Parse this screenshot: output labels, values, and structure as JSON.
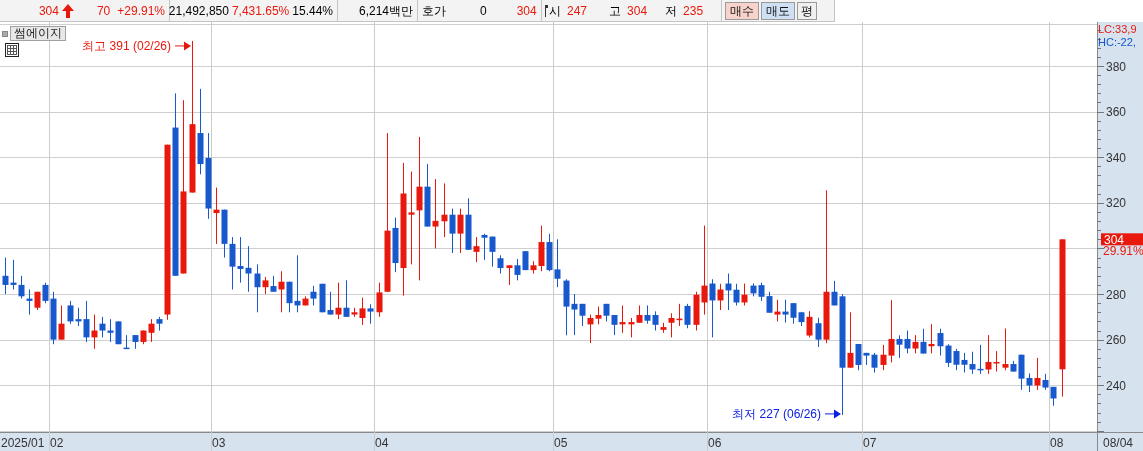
{
  "quote_bar": {
    "price": "304",
    "change": "70",
    "change_rate": "+29.91%",
    "volume": "21,492,850",
    "volume_rate": "7,431.65%",
    "turnover_rate": "15.44%",
    "amount": "6,214백만",
    "bid_ask_label": "호가",
    "bid_ask_qty": "0",
    "bid_ask_price": "304",
    "open_label": "시",
    "open": "247",
    "high_label": "고",
    "high": "304",
    "low_label": "저",
    "low": "235"
  },
  "buttons": [
    {
      "label": "매수",
      "kind": "buy"
    },
    {
      "label": "매도",
      "kind": "sell"
    },
    {
      "label": "평",
      "kind": "plain"
    }
  ],
  "chart": {
    "stock_button": "썸에이지",
    "lc_label": "LC:33,9",
    "hc_label": "HC:-22,",
    "last_price_tag": "304",
    "last_change_tag": "29.91%",
    "x_axis_start_label": "2025/01",
    "x_axis_end_label": "08/04",
    "chart_data": {
      "type": "candlestick",
      "grid": true,
      "ylim": [
        219.5,
        399.3
      ],
      "yticks": [
        240,
        260,
        280,
        320,
        340,
        360,
        380
      ],
      "categories": [
        null,
        null,
        null,
        null,
        null,
        null,
        "02",
        null,
        null,
        null,
        null,
        null,
        null,
        null,
        null,
        null,
        null,
        null,
        null,
        null,
        null,
        null,
        null,
        null,
        null,
        null,
        "03",
        null,
        null,
        null,
        null,
        null,
        null,
        null,
        null,
        null,
        null,
        null,
        null,
        null,
        null,
        null,
        null,
        null,
        null,
        null,
        "04",
        null,
        null,
        null,
        null,
        null,
        null,
        null,
        null,
        null,
        null,
        null,
        null,
        null,
        null,
        null,
        null,
        null,
        null,
        null,
        null,
        null,
        "05",
        null,
        null,
        null,
        null,
        null,
        null,
        null,
        null,
        null,
        null,
        null,
        null,
        null,
        null,
        null,
        null,
        null,
        null,
        "06",
        null,
        null,
        null,
        null,
        null,
        null,
        null,
        null,
        null,
        null,
        null,
        null,
        null,
        null,
        null,
        null,
        null,
        null,
        "07",
        null,
        null,
        null,
        null,
        null,
        null,
        null,
        null,
        null,
        null,
        null,
        null,
        null,
        null,
        null,
        null,
        null,
        null,
        null,
        null,
        null,
        null,
        "08",
        null
      ],
      "ohlc": [
        [
          288,
          296,
          280,
          284
        ],
        [
          285,
          295,
          282,
          284
        ],
        [
          284,
          288,
          278,
          279
        ],
        [
          278,
          282,
          271,
          277
        ],
        [
          274,
          281,
          273,
          281
        ],
        [
          284,
          285,
          276,
          277
        ],
        [
          278,
          281,
          258,
          260
        ],
        [
          260,
          275,
          260,
          267
        ],
        [
          275,
          277,
          267,
          268
        ],
        [
          269,
          274,
          266,
          268
        ],
        [
          269,
          277,
          259,
          261
        ],
        [
          261,
          271,
          256,
          264
        ],
        [
          267,
          270,
          261,
          264
        ],
        [
          264,
          269,
          259,
          263
        ],
        [
          268,
          268,
          258,
          258
        ],
        [
          256.5,
          262,
          256,
          256
        ],
        [
          262,
          262,
          256,
          259
        ],
        [
          259,
          264,
          258,
          264
        ],
        [
          263,
          269,
          259,
          267
        ],
        [
          269,
          270,
          264,
          267
        ],
        [
          271,
          345.5,
          268.7,
          345.5
        ],
        [
          353,
          368,
          288,
          288
        ],
        [
          289,
          365,
          289,
          325
        ],
        [
          324.5,
          391,
          324.5,
          354.5
        ],
        [
          350.6,
          370,
          332.5,
          337
        ],
        [
          339.7,
          350.6,
          313,
          317.5
        ],
        [
          315.5,
          326.7,
          302,
          317
        ],
        [
          317,
          317,
          296,
          302
        ],
        [
          302,
          305,
          282,
          292
        ],
        [
          292.3,
          305,
          285,
          291
        ],
        [
          291.5,
          301,
          281,
          289
        ],
        [
          289,
          293,
          272,
          283
        ],
        [
          283,
          287.5,
          280,
          286
        ],
        [
          283.5,
          288,
          281,
          281
        ],
        [
          282,
          290,
          272,
          285.4
        ],
        [
          285.4,
          285.4,
          272,
          276
        ],
        [
          277,
          297,
          272,
          275
        ],
        [
          275,
          279,
          275,
          278
        ],
        [
          281,
          283.6,
          275,
          278
        ],
        [
          284.5,
          284.5,
          272,
          272
        ],
        [
          273,
          281,
          271,
          271
        ],
        [
          271,
          285,
          269,
          274
        ],
        [
          274,
          286,
          270,
          270
        ],
        [
          271,
          274,
          270,
          272
        ],
        [
          269.5,
          278.4,
          266.5,
          273.7
        ],
        [
          273.7,
          275.5,
          267,
          272.3
        ],
        [
          272,
          285,
          270,
          280.7
        ],
        [
          281,
          350.6,
          281,
          307.8
        ],
        [
          309,
          313.5,
          289.6,
          293.6
        ],
        [
          291.4,
          337.5,
          279.3,
          324.1
        ],
        [
          314.8,
          333.7,
          293,
          315.8
        ],
        [
          316.7,
          348.9,
          286,
          327.1
        ],
        [
          327.1,
          337,
          309.6,
          309.6
        ],
        [
          309.6,
          330.4,
          300,
          312.1
        ],
        [
          311.9,
          328.5,
          305,
          314.8
        ],
        [
          314.8,
          317.5,
          298,
          306.5
        ],
        [
          306.5,
          317.5,
          298,
          314.8
        ],
        [
          314.8,
          322,
          299.4,
          299.4
        ],
        [
          298.5,
          305,
          294,
          301
        ],
        [
          305.9,
          306.4,
          295,
          304.7
        ],
        [
          305.2,
          305.2,
          292,
          298.5
        ],
        [
          295.7,
          297,
          289,
          291.4
        ],
        [
          291.4,
          292.6,
          284,
          292.6
        ],
        [
          292.6,
          295.4,
          286,
          288.4
        ],
        [
          298.8,
          298.8,
          290.5,
          290.5
        ],
        [
          290.5,
          294.4,
          289,
          292.6
        ],
        [
          292.3,
          310,
          290,
          302.8
        ],
        [
          302.8,
          306.4,
          290,
          290.5
        ],
        [
          290.8,
          304,
          283,
          286.7
        ],
        [
          285.9,
          286.5,
          261.9,
          274.5
        ],
        [
          275.7,
          280,
          262,
          273.2
        ],
        [
          275.7,
          275.7,
          266,
          270.5
        ],
        [
          266.7,
          271,
          258.5,
          269.5
        ],
        [
          269.2,
          274.5,
          266.7,
          270.8
        ],
        [
          275.7,
          275.7,
          268,
          270.5
        ],
        [
          270.8,
          270.8,
          262,
          266.5
        ],
        [
          266.7,
          275,
          263,
          267.7
        ],
        [
          266.7,
          269.5,
          261,
          267.7
        ],
        [
          267.4,
          275,
          267.4,
          270.8
        ],
        [
          270.8,
          275,
          267,
          268.3
        ],
        [
          270.8,
          272.4,
          264,
          266.5
        ],
        [
          264.3,
          267.4,
          263,
          265.5
        ],
        [
          267.4,
          271.6,
          261,
          269.5
        ],
        [
          269,
          275.7,
          266,
          269.2
        ],
        [
          274.8,
          275.7,
          265,
          266.5
        ],
        [
          266.5,
          281,
          264,
          279.7
        ],
        [
          276.3,
          310,
          271,
          283.7
        ],
        [
          284.6,
          286.5,
          261,
          277.2
        ],
        [
          277.2,
          284.5,
          273,
          282
        ],
        [
          284.6,
          289,
          273,
          281.6
        ],
        [
          281.9,
          284.5,
          275,
          276.3
        ],
        [
          276.3,
          284.6,
          275,
          279.7
        ],
        [
          283.7,
          284.7,
          279,
          280.3
        ],
        [
          283.9,
          285,
          277,
          278.8
        ],
        [
          279.1,
          281,
          271.8,
          271.8
        ],
        [
          271,
          277.5,
          268,
          272.3
        ],
        [
          272.3,
          277.5,
          267.5,
          271
        ],
        [
          276,
          276,
          267,
          269.6
        ],
        [
          272,
          272.2,
          266,
          267.7
        ],
        [
          261.8,
          272.5,
          261,
          270
        ],
        [
          267.2,
          269.6,
          256.8,
          260
        ],
        [
          260,
          325.5,
          258.5,
          281
        ],
        [
          281,
          285.8,
          275,
          275
        ],
        [
          279,
          280,
          227,
          247.7
        ],
        [
          247.7,
          272,
          247.7,
          254.2
        ],
        [
          258.1,
          258.1,
          246.6,
          248.9
        ],
        [
          254.2,
          254.2,
          248.9,
          253
        ],
        [
          253.4,
          254.2,
          245.6,
          247.7
        ],
        [
          248.9,
          257.7,
          246.6,
          253.4
        ],
        [
          253,
          277.3,
          250,
          260.3
        ],
        [
          260.3,
          261.9,
          252,
          257.8
        ],
        [
          260.3,
          264,
          254,
          256.1
        ],
        [
          256.1,
          262,
          254,
          259
        ],
        [
          259,
          264.8,
          253.9,
          253.9
        ],
        [
          257.1,
          266.8,
          254,
          258.1
        ],
        [
          262.9,
          264.8,
          253,
          257.1
        ],
        [
          257.4,
          258,
          248,
          249.8
        ],
        [
          255,
          256,
          246.6,
          249
        ],
        [
          251.1,
          254.2,
          245.6,
          249
        ],
        [
          249.3,
          254.7,
          245,
          246.9
        ],
        [
          247.2,
          257.7,
          245,
          247
        ],
        [
          246.9,
          262,
          245,
          250.2
        ],
        [
          250,
          255,
          246,
          250.2
        ],
        [
          247.7,
          264.9,
          246.6,
          249.3
        ],
        [
          249.3,
          250.7,
          246,
          246
        ],
        [
          253.4,
          253.4,
          238,
          242.9
        ],
        [
          243.2,
          245.2,
          237,
          239.9
        ],
        [
          239.9,
          252,
          238,
          243.2
        ],
        [
          242.3,
          245,
          238,
          239
        ],
        [
          239.3,
          239.3,
          231,
          234.2
        ],
        [
          247,
          304,
          235,
          304
        ]
      ],
      "annotations": [
        "최고 391 (02/26)",
        "최저 227 (06/26)"
      ]
    }
  }
}
